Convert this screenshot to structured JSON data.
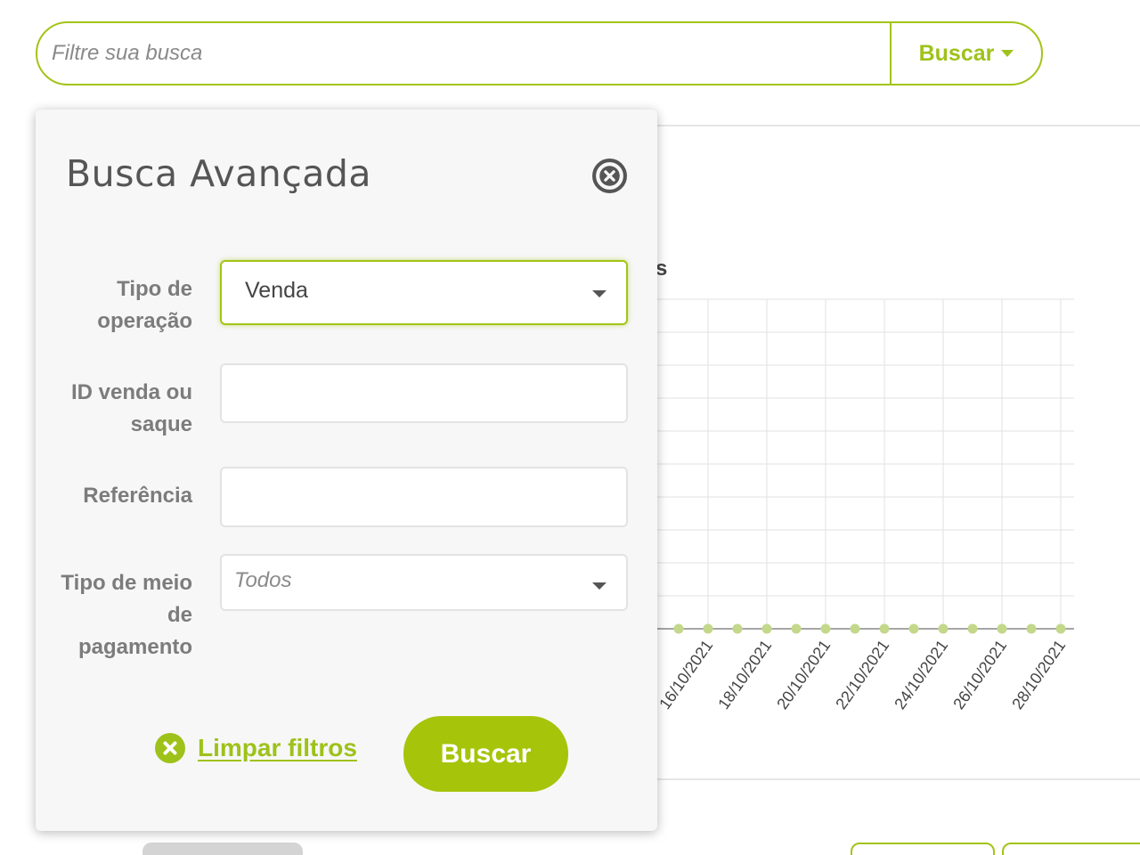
{
  "search": {
    "placeholder": "Filtre sua busca",
    "button_label": "Buscar",
    "button_icon": "caret-down-icon"
  },
  "chart": {
    "title_fragment": "s",
    "x_tick_labels": [
      "16/10/2021",
      "18/10/2021",
      "20/10/2021",
      "22/10/2021",
      "24/10/2021",
      "26/10/2021",
      "28/10/2021"
    ],
    "point_count": 14,
    "point_values": [
      0,
      0,
      0,
      0,
      0,
      0,
      0,
      0,
      0,
      0,
      0,
      0,
      0,
      0
    ]
  },
  "modal": {
    "title": "Busca Avançada",
    "close_icon": "close-circle-icon",
    "fields": [
      {
        "label_line1": "Tipo de",
        "label_line2": "operação",
        "value": "Venda"
      },
      {
        "label_line1": "ID venda ou",
        "label_line2": "saque",
        "value": ""
      },
      {
        "label": "Referência",
        "value": ""
      },
      {
        "label_line1": "Tipo de meio",
        "label_line2": "de",
        "label_line3": "pagamento",
        "placeholder": "Todos"
      }
    ],
    "clear_filters_label": "Limpar filtros",
    "clear_filters_icon": "clear-circle-icon",
    "search_button_label": "Buscar"
  },
  "colors": {
    "accent": "#a3c417",
    "button_fill": "#a6c40a",
    "label_gray": "#7c7c7c",
    "chart_point": "#c3d88a"
  }
}
